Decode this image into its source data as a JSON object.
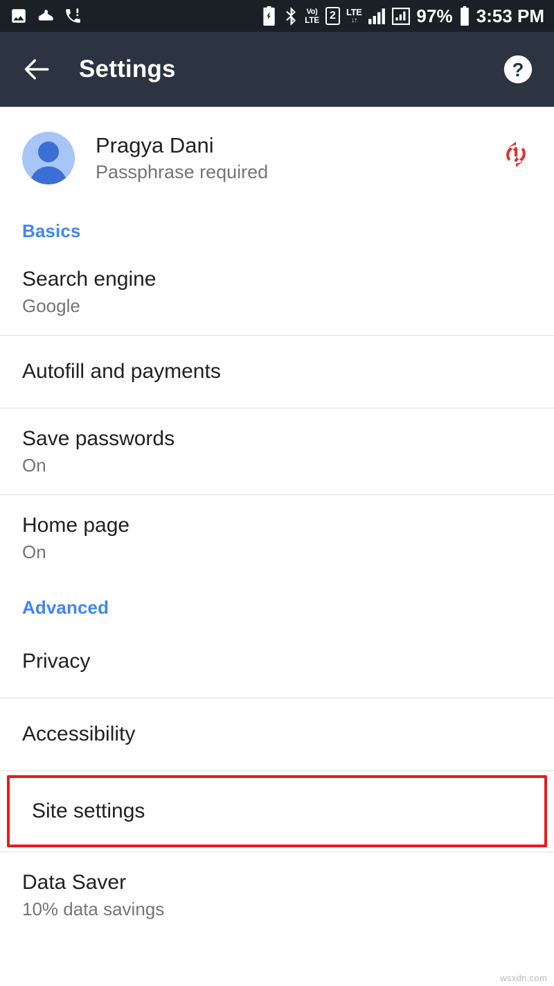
{
  "statusbar": {
    "left_icons": [
      "image-icon",
      "shoe-tracking-icon",
      "missed-call-icon"
    ],
    "right_icons": [
      "battery-saver-icon",
      "bluetooth-icon",
      "volte-icon",
      "sim-2-icon",
      "lte-data-icon",
      "signal-bars-icon",
      "signal-secondary-icon"
    ],
    "volte_top": "Vo)",
    "volte_bottom": "LTE",
    "sim_label": "2",
    "lte_label": "LTE",
    "lte_arrows": "↓↑",
    "battery_percent": "97%",
    "time": "3:53 PM"
  },
  "toolbar": {
    "back_label": "back-arrow",
    "title": "Settings",
    "help_label": "help"
  },
  "account": {
    "name": "Pragya Dani",
    "status": "Passphrase required",
    "sync_state": "sync-error",
    "avatar_bg": "#a7c5f7",
    "avatar_fg": "#3c6fd6",
    "error_color": "#e03131"
  },
  "sections": [
    {
      "header": "Basics",
      "items": [
        {
          "title": "Search engine",
          "subtitle": "Google"
        },
        {
          "title": "Autofill and payments",
          "subtitle": ""
        },
        {
          "title": "Save passwords",
          "subtitle": "On"
        },
        {
          "title": "Home page",
          "subtitle": "On"
        }
      ]
    },
    {
      "header": "Advanced",
      "items": [
        {
          "title": "Privacy",
          "subtitle": ""
        },
        {
          "title": "Accessibility",
          "subtitle": ""
        },
        {
          "title": "Site settings",
          "subtitle": "",
          "highlighted": true
        },
        {
          "title": "Data Saver",
          "subtitle": "10% data savings"
        }
      ]
    }
  ],
  "colors": {
    "statusbar_bg": "#1a2025",
    "toolbar_bg": "#2b3440",
    "accent_blue": "#4285f4",
    "highlight_red": "#e81c1c",
    "divider": "#e0e0e0"
  },
  "watermark": "wsxdn.com"
}
